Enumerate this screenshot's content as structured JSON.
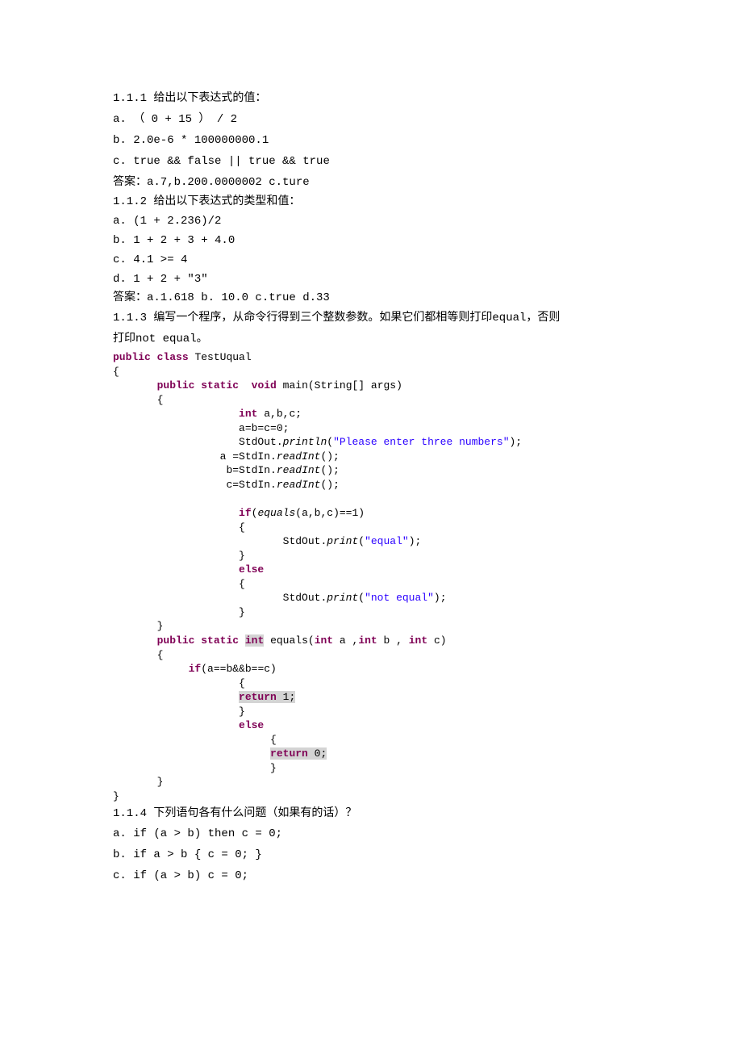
{
  "q111": {
    "heading": "1.1.1 给出以下表达式的值：",
    "a": "a. （ 0 + 15 ） / 2",
    "b": "b. 2.0e-6 * 100000000.1",
    "c": "c. true && false || true && true",
    "answer": "答案：a.7,b.200.0000002  c.ture"
  },
  "q112": {
    "heading": "1.1.2 给出以下表达式的类型和值：",
    "a": "a. (1 + 2.236)/2",
    "b": "b. 1 + 2 + 3 + 4.0",
    "c": "c. 4.1 >= 4",
    "d": "d. 1 + 2 + \"3\"",
    "answer": "答案：a.1.618  b. 10.0  c.true  d.33"
  },
  "q113": {
    "heading1": "1.1.3   编写一个程序，从命令行得到三个整数参数。如果它们都相等则打印equal，否则",
    "heading2": "打印not equal。",
    "code": {
      "kw_public": "public",
      "kw_class": "class",
      "class_name": " TestUqual",
      "kw_static": "static",
      "kw_void": "void",
      "main_sig": " main(String[] args)",
      "kw_int": "int",
      "decl_abc": " a,b,c;",
      "init_abc": "a=b=c=0;",
      "stdout_println": "StdOut.",
      "println": "println",
      "str_prompt": "\"Please enter three numbers\"",
      "assign_a": "a =StdIn.",
      "readInt": "readInt",
      "assign_b": "b=StdIn.",
      "assign_c": "c=StdIn.",
      "kw_if": "if",
      "equals_call": "equals",
      "cond1": "(a,b,c)==1)",
      "stdout_print": "StdOut.",
      "print": "print",
      "str_equal": "\"equal\"",
      "kw_else": "else",
      "str_not_equal": "\"not equal\"",
      "equals_sig1": " equals(",
      "equals_sig_a": " a ,",
      "equals_sig_b": " b , ",
      "equals_sig_c": " c)",
      "cond2": "(a==b&&b==c)",
      "kw_return": "return",
      "one": " 1;",
      "zero": " 0;"
    }
  },
  "q114": {
    "heading": "1.1.4  下列语句各有什么问题（如果有的话）？",
    "a": "a. if (a > b) then c = 0;",
    "b": "b. if a > b { c = 0; }",
    "c": "c. if (a > b) c = 0;"
  }
}
